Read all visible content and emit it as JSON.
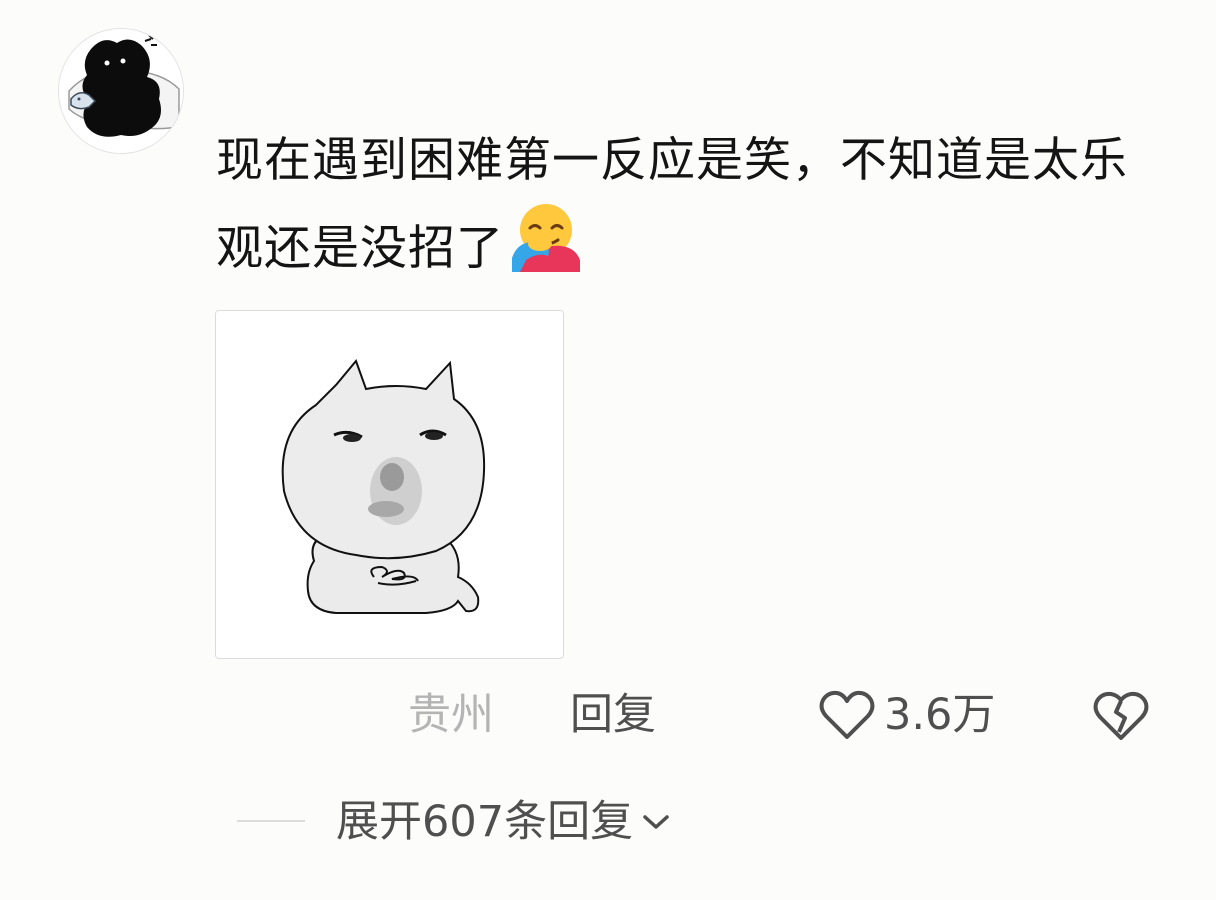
{
  "comment": {
    "text": "现在遇到困难第一反应是笑，不知道是太乐观还是没招了",
    "emoji_icon": "hugging-face-emoji"
  },
  "meta": {
    "location": "贵州",
    "reply_label": "回复",
    "like_count": "3.6万",
    "like_icon": "heart-outline-icon",
    "dislike_icon": "broken-heart-icon"
  },
  "replies": {
    "expand_label": "展开607条回复",
    "chevron_icon": "chevron-down-icon"
  },
  "colors": {
    "text_primary": "#141414",
    "text_secondary": "#4f4f4f",
    "text_muted": "#b4b4b4",
    "background": "#fcfcfa"
  }
}
